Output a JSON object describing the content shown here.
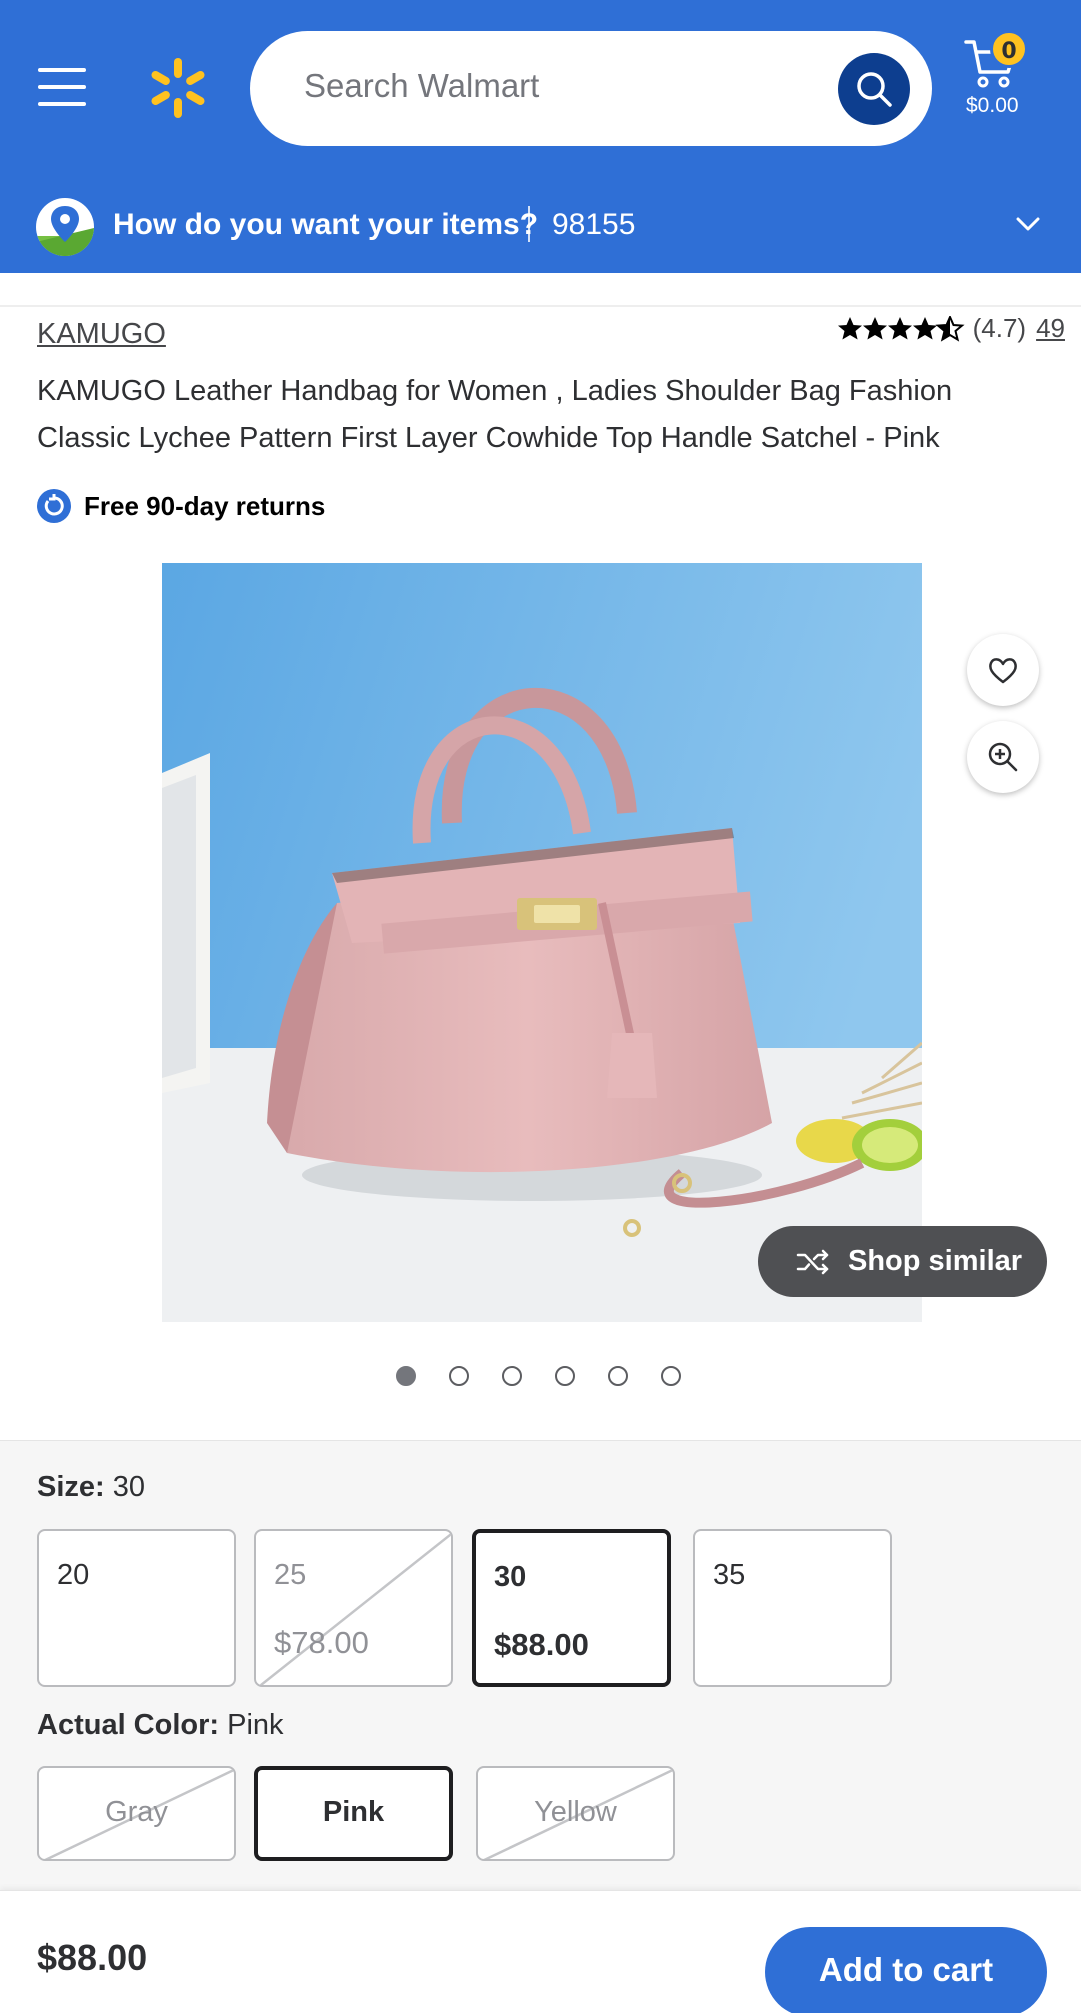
{
  "header": {
    "search_placeholder": "Search Walmart",
    "cart_count": "0",
    "cart_total": "$0.00",
    "fulfillment_question": "How do you want your items?",
    "zip": "98155"
  },
  "product": {
    "brand": "KAMUGO",
    "rating": "(4.7)",
    "rating_value": 4.7,
    "review_count": "49",
    "title": "KAMUGO Leather Handbag for Women , Ladies Shoulder Bag Fashion Classic Lychee Pattern First Layer Cowhide Top Handle Satchel - Pink",
    "returns": "Free 90-day returns",
    "shop_similar": "Shop similar",
    "image_count": 6,
    "active_image": 1
  },
  "variants": {
    "size_label": "Size:",
    "size_value": "30",
    "sizes": [
      {
        "size": "20",
        "price": "",
        "available": true,
        "selected": false
      },
      {
        "size": "25",
        "price": "$78.00",
        "available": false,
        "selected": false
      },
      {
        "size": "30",
        "price": "$88.00",
        "available": true,
        "selected": true
      },
      {
        "size": "35",
        "price": "",
        "available": true,
        "selected": false
      }
    ],
    "color_label": "Actual Color:",
    "color_value": "Pink",
    "colors": [
      {
        "name": "Gray",
        "available": false,
        "selected": false
      },
      {
        "name": "Pink",
        "available": true,
        "selected": true
      },
      {
        "name": "Yellow",
        "available": false,
        "selected": false
      }
    ]
  },
  "bottom": {
    "price": "$88.00",
    "add_to_cart": "Add to cart"
  },
  "colors": {
    "brand_blue": "#2f6fd6",
    "spark_yellow": "#ffc220",
    "dark_blue": "#0d3e8f"
  }
}
